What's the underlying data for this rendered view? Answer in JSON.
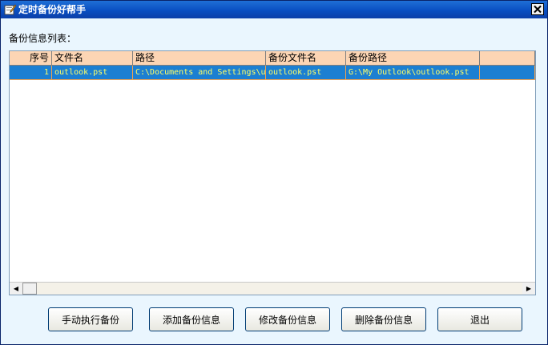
{
  "window": {
    "title": "定时备份好帮手",
    "close_glyph": "×"
  },
  "list_label": "备份信息列表：",
  "table": {
    "columns": [
      "序号",
      "文件名",
      "路径",
      "备份文件名",
      "备份路径",
      ""
    ],
    "rows": [
      [
        "1",
        "outlook.pst",
        "C:\\Documents and Settings\\u",
        "outlook.pst",
        "G:\\My Outlook\\outlook.pst",
        ""
      ]
    ],
    "selected_row_color": "#1c7fd2",
    "selected_text_color": "#ffff66",
    "header_color": "#fcd5b4"
  },
  "scrollbar": {
    "left_arrow": "◀",
    "right_arrow": "▶"
  },
  "buttons": {
    "run_backup": "手动执行备份",
    "add_backup": "添加备份信息",
    "edit_backup": "修改备份信息",
    "delete_backup": "删除备份信息",
    "exit": "退出"
  }
}
